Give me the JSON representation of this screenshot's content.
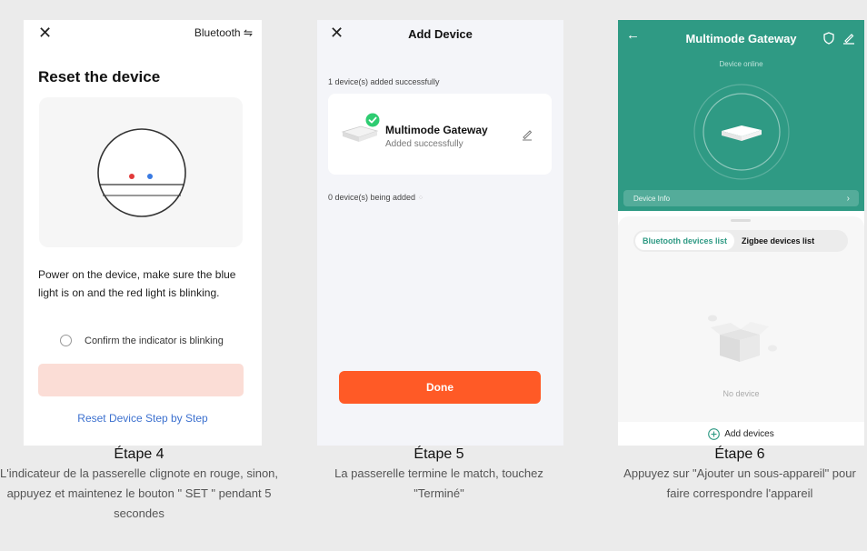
{
  "screen1": {
    "close_glyph": "✕",
    "bluetooth_label": "Bluetooth",
    "title": "Reset the device",
    "description": "Power on the device, make sure the blue light is on and the red light is blinking.",
    "confirm_label": "Confirm the indicator is blinking",
    "reset_link": "Reset Device Step by Step"
  },
  "screen2": {
    "close_glyph": "✕",
    "title": "Add Device",
    "added_count": "1 device(s) added successfully",
    "device_name": "Multimode Gateway",
    "device_status": "Added successfully",
    "being_added": "0 device(s) being added",
    "done_label": "Done"
  },
  "screen3": {
    "title": "Multimode Gateway",
    "status": "Device online",
    "info_label": "Device Info",
    "tab_bluetooth": "Bluetooth devices list",
    "tab_zigbee": "Zigbee devices list",
    "empty_label": "No device",
    "add_label": "Add devices"
  },
  "captions": [
    {
      "step": "Étape 4",
      "text": "L'indicateur de la passerelle clignote en rouge, sinon, appuyez et maintenez le bouton \" SET \" pendant 5 secondes"
    },
    {
      "step": "Étape 5",
      "text": "La passerelle termine le match, touchez \"Terminé\""
    },
    {
      "step": "Étape 6",
      "text": "Appuyez sur \"Ajouter un sous-appareil\" pour faire correspondre l'appareil"
    }
  ],
  "colors": {
    "accent_orange": "#ff5a26",
    "teal": "#2f9a84",
    "link_blue": "#3d71cf",
    "success_green": "#2ecc71"
  },
  "icons": [
    "close-icon",
    "bluetooth-icon",
    "check-icon",
    "edit-icon",
    "back-icon",
    "shield-icon",
    "chevron-right-icon",
    "add-circle-icon",
    "empty-box-icon"
  ]
}
